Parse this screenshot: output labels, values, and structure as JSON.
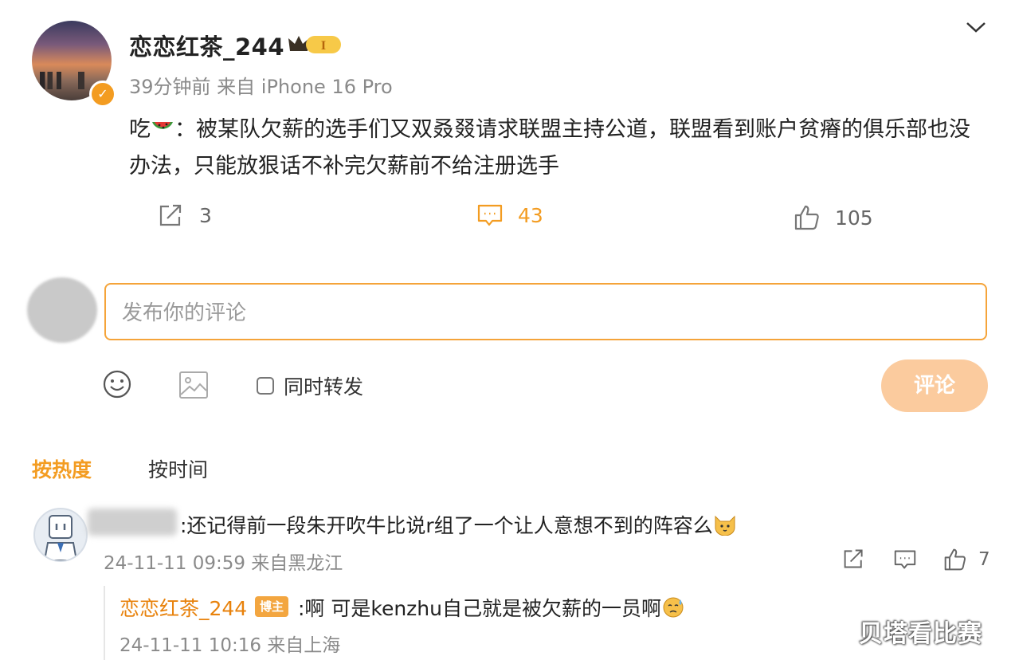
{
  "post": {
    "username": "恋恋红茶_244",
    "vip_level": "I",
    "meta": "39分钟前 来自 iPhone 16 Pro",
    "content_prefix": "吃",
    "content_body": "：被某队欠薪的选手们又双叒叕请求联盟主持公道，联盟看到账户贫瘠的俱乐部也没办法，只能放狠话不补完欠薪前不给注册选手",
    "repost_count": "3",
    "comment_count": "43",
    "like_count": "105"
  },
  "compose": {
    "placeholder": "发布你的评论",
    "repost_label": "同时转发",
    "submit_label": "评论"
  },
  "sort": {
    "hot_label": "按热度",
    "time_label": "按时间"
  },
  "comments": [
    {
      "text": ":还记得前一段朱开吹牛比说r组了一个让人意想不到的阵容么",
      "meta": "24-11-11 09:59 来自黑龙江",
      "like_count": "7",
      "reply": {
        "username": "恋恋红茶_244",
        "badge": "博主",
        "text": ":啊 可是kenzhu自己就是被欠薪的一员啊",
        "meta": "24-11-11 10:16 来自上海"
      }
    }
  ],
  "watermark": "贝塔看比赛",
  "colors": {
    "accent": "#f39c21",
    "input_border": "#f5a43a",
    "submit_disabled": "#fbcb9e",
    "reply_name": "#e8820c",
    "meta_gray": "#8a8a8a"
  },
  "icons": [
    "chevron-down-icon",
    "verified-icon",
    "repost-icon",
    "comment-icon",
    "like-icon",
    "emoji-icon",
    "image-icon",
    "watermelon-emoji",
    "cat-emoji",
    "sweat-emoji"
  ]
}
